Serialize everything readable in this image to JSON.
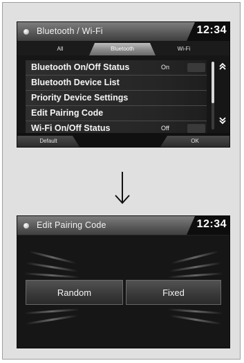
{
  "screen1": {
    "title": "Bluetooth / Wi-Fi",
    "clock": "12:34",
    "tabs": [
      {
        "label": "All",
        "active": false
      },
      {
        "label": "Bluetooth",
        "active": true
      },
      {
        "label": "Wi-Fi",
        "active": false
      }
    ],
    "rows": [
      {
        "label": "Bluetooth On/Off Status",
        "value": "On"
      },
      {
        "label": "Bluetooth Device List",
        "value": ""
      },
      {
        "label": "Priority Device Settings",
        "value": ""
      },
      {
        "label": "Edit Pairing Code",
        "value": ""
      },
      {
        "label": "Wi-Fi On/Off Status",
        "value": "Off"
      }
    ],
    "buttons": {
      "default": "Default",
      "ok": "OK"
    }
  },
  "arrow_icon": "down-arrow-icon",
  "screen2": {
    "title": "Edit Pairing Code",
    "clock": "12:34",
    "options": {
      "random": "Random",
      "fixed": "Fixed"
    }
  }
}
